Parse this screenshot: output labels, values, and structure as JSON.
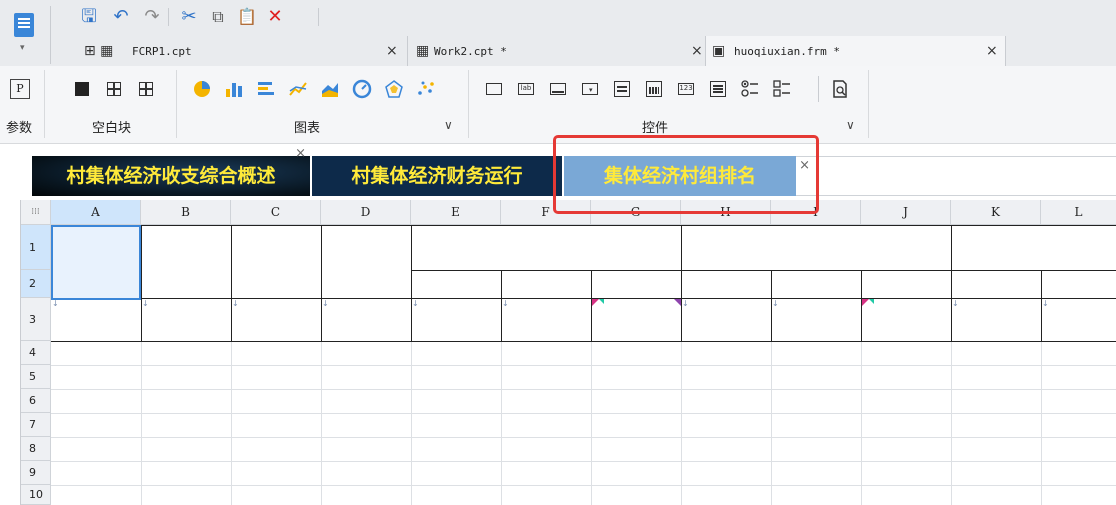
{
  "quick_toolbar": {
    "buttons": [
      {
        "name": "save-icon",
        "glyph": "🖫"
      },
      {
        "name": "undo-icon",
        "glyph": "↶"
      },
      {
        "name": "redo-icon",
        "glyph": "↷"
      },
      {
        "name": "cut-icon",
        "glyph": "✂"
      },
      {
        "name": "copy-icon",
        "glyph": "⧉"
      },
      {
        "name": "paste-icon",
        "glyph": "📋"
      },
      {
        "name": "delete-icon",
        "glyph": "✕"
      }
    ]
  },
  "file_tabs": [
    {
      "label": "FCRP1.cpt",
      "close": "×",
      "active": false
    },
    {
      "label": "Work2.cpt *",
      "close": "×",
      "active": false
    },
    {
      "label": "huoqiuxian.frm *",
      "close": "×",
      "active": true
    }
  ],
  "ribbon": {
    "param_label": "参数",
    "blank_block_label": "空白块",
    "chart_label": "图表",
    "widget_label": "控件",
    "expand_glyph": "∨"
  },
  "report_tabs": [
    {
      "label": "村集体经济收支综合概述",
      "close": "×"
    },
    {
      "label": "村集体经济财务运行",
      "close": ""
    },
    {
      "label": "集体经济村组排名",
      "close": "×"
    }
  ],
  "sheet": {
    "corner_glyph": "⁞⁞⁞",
    "columns": [
      "A",
      "B",
      "C",
      "D",
      "E",
      "F",
      "G",
      "H",
      "I",
      "J",
      "K",
      "L"
    ],
    "rows": [
      "1",
      "2",
      "3",
      "4",
      "5",
      "6",
      "7",
      "8",
      "9",
      "10"
    ],
    "selected_cell": "A1"
  },
  "colors": {
    "accent": "#3a86d8",
    "highlight_box": "#e53935",
    "tab_text": "#ffea3a",
    "active_tab_bg": "#7aa8d6"
  }
}
